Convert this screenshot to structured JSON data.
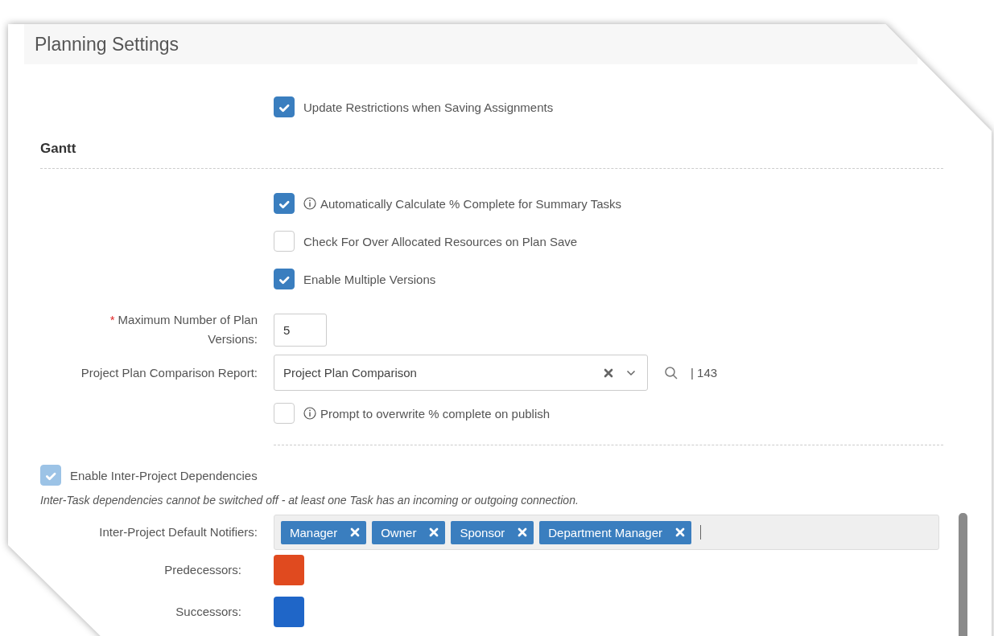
{
  "title": "Planning Settings",
  "top_options": [
    {
      "kind": "checkbox",
      "label": "Update Restrictions when Saving Assignments",
      "checked": true,
      "info": false
    }
  ],
  "gantt": {
    "heading": "Gantt",
    "rows": [
      {
        "kind": "checkbox",
        "label": "Automatically Calculate % Complete for Summary Tasks",
        "checked": true,
        "info": true
      },
      {
        "kind": "checkbox",
        "label": "Check For Over Allocated Resources on Plan Save",
        "checked": false,
        "info": false
      },
      {
        "kind": "checkbox",
        "label": "Enable Multiple Versions",
        "checked": true,
        "info": false
      },
      {
        "kind": "number",
        "required_mark": "*",
        "label": "Maximum Number of Plan Versions:",
        "value": "5"
      },
      {
        "kind": "lookup",
        "label": "Project Plan Comparison Report:",
        "value": "Project Plan Comparison",
        "count": "| 143"
      },
      {
        "kind": "checkbox",
        "label": "Prompt to overwrite % complete on publish",
        "checked": false,
        "info": true
      }
    ]
  },
  "dependencies": {
    "toggle": {
      "label": "Enable Inter-Project Dependencies",
      "checked": true,
      "disabled": true
    },
    "note": "Inter-Task dependencies cannot be switched off - at least one Task has an incoming or outgoing connection.",
    "notifiers": {
      "label": "Inter-Project Default Notifiers:",
      "tags": [
        "Manager",
        "Owner",
        "Sponsor",
        "Department Manager"
      ]
    },
    "colors": [
      {
        "label": "Predecessors:",
        "color": "#e04a1f"
      },
      {
        "label": "Successors:",
        "color": "#1f66c8"
      }
    ]
  }
}
